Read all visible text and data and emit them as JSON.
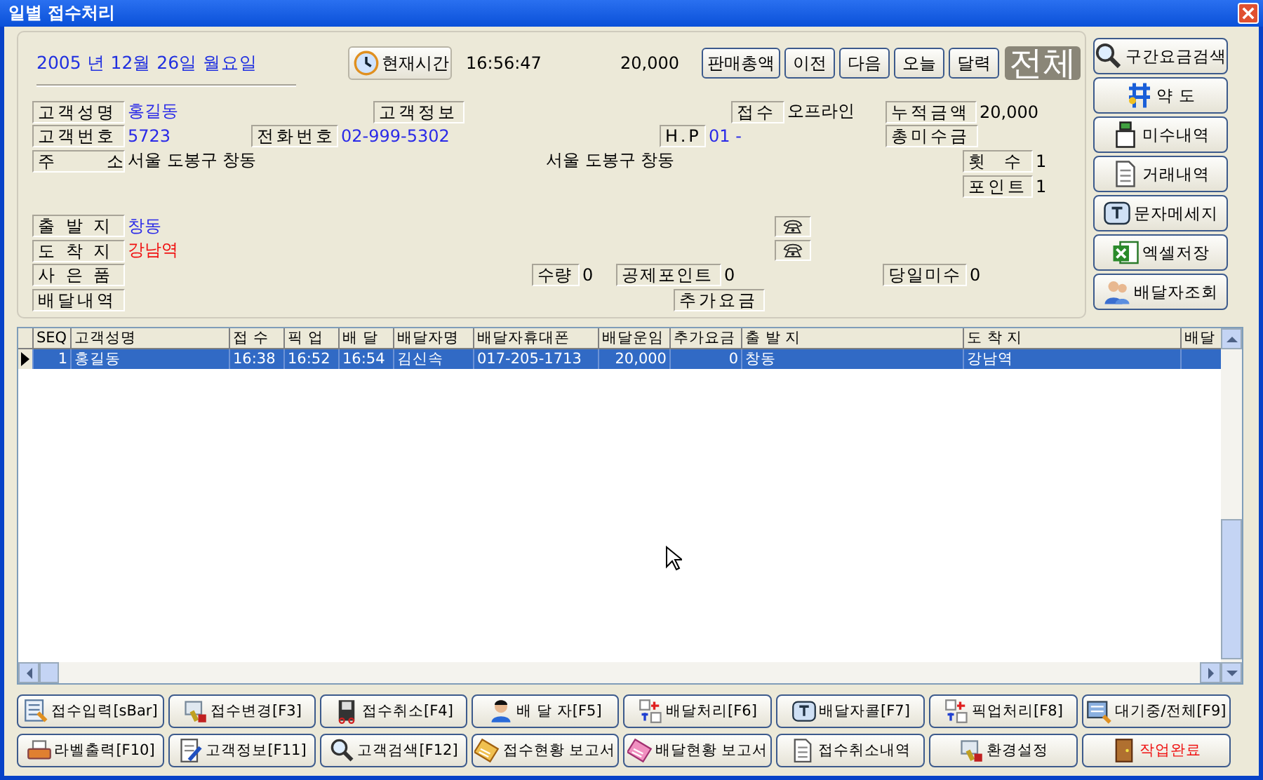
{
  "window": {
    "title": "일별 접수처리"
  },
  "top_bar": {
    "date": "2005 년   12월   26일  월요일",
    "time_button": "현재시간",
    "time": "16:56:47",
    "amount": "20,000",
    "nav_buttons": [
      "판매총액",
      "이전",
      "다음",
      "오늘",
      "달력"
    ],
    "view_label": "전체"
  },
  "customer": {
    "name_label": "고객성명",
    "name": "홍길동",
    "info_label": "고객정보",
    "reception_label": "접수",
    "reception": "오프라인",
    "total_label": "누적금액",
    "total": "20,000",
    "number_label": "고객번호",
    "number": "5723",
    "phone_label": "전화번호",
    "phone": "02-999-5302",
    "hp_label": "H.P",
    "hp": "01 -",
    "unpaid_label": "총미수금",
    "address_label": "주      소",
    "address": "서울 도봉구 창동",
    "address2": "서울 도봉구 창동",
    "count_label": "횟  수",
    "count": "1",
    "point_label": "포인트",
    "point": "1",
    "departure_label": "출 발 지",
    "departure": "창동",
    "arrival_label": "도 착 지",
    "arrival": "강남역",
    "gift_label": "사 은 품",
    "qty_label": "수량",
    "qty": "0",
    "deduct_label": "공제포인트",
    "deduct": "0",
    "daily_label": "당일미수",
    "daily": "0",
    "history_label": "배달내역",
    "extra_label": "추가요금"
  },
  "side_buttons": [
    "구간요금검색",
    "약 도",
    "미수내역",
    "거래내역",
    "문자메세지",
    "엑셀저장",
    "배달자조회"
  ],
  "table": {
    "columns": [
      "SEQ",
      "고객성명",
      "접 수",
      "픽 업",
      "배 달",
      "배달자명",
      "배달자휴대폰",
      "배달운임",
      "추가요금",
      "출 발 지",
      "도 착 지",
      "배달"
    ],
    "rows": [
      {
        "selected": true,
        "cells": [
          "1",
          "홍길동",
          "16:38",
          "16:52",
          "16:54",
          "김신속",
          "017-205-1713",
          "20,000",
          "0",
          "창동",
          "강남역"
        ]
      }
    ]
  },
  "bottom_buttons": [
    {
      "label": "접수입력[sBar]",
      "kind": "normal"
    },
    {
      "label": "접수변경[F3]",
      "kind": "normal"
    },
    {
      "label": "접수취소[F4]",
      "kind": "normal"
    },
    {
      "label": "배 달 자[F5]",
      "kind": "normal"
    },
    {
      "label": "배달처리[F6]",
      "kind": "normal"
    },
    {
      "label": "배달자콜[F7]",
      "kind": "normal"
    },
    {
      "label": "픽업처리[F8]",
      "kind": "normal"
    },
    {
      "label": "대기중/전체[F9]",
      "kind": "normal"
    },
    {
      "label": "라벨출력[F10]",
      "kind": "normal"
    },
    {
      "label": "고객정보[F11]",
      "kind": "normal"
    },
    {
      "label": "고객검색[F12]",
      "kind": "normal"
    },
    {
      "label": "접수현황 보고서",
      "kind": "normal"
    },
    {
      "label": "배달현황 보고서",
      "kind": "normal"
    },
    {
      "label": "접수취소내역",
      "kind": "normal"
    },
    {
      "label": "환경설정",
      "kind": "normal"
    },
    {
      "label": "작업완료",
      "kind": "exit"
    }
  ]
}
